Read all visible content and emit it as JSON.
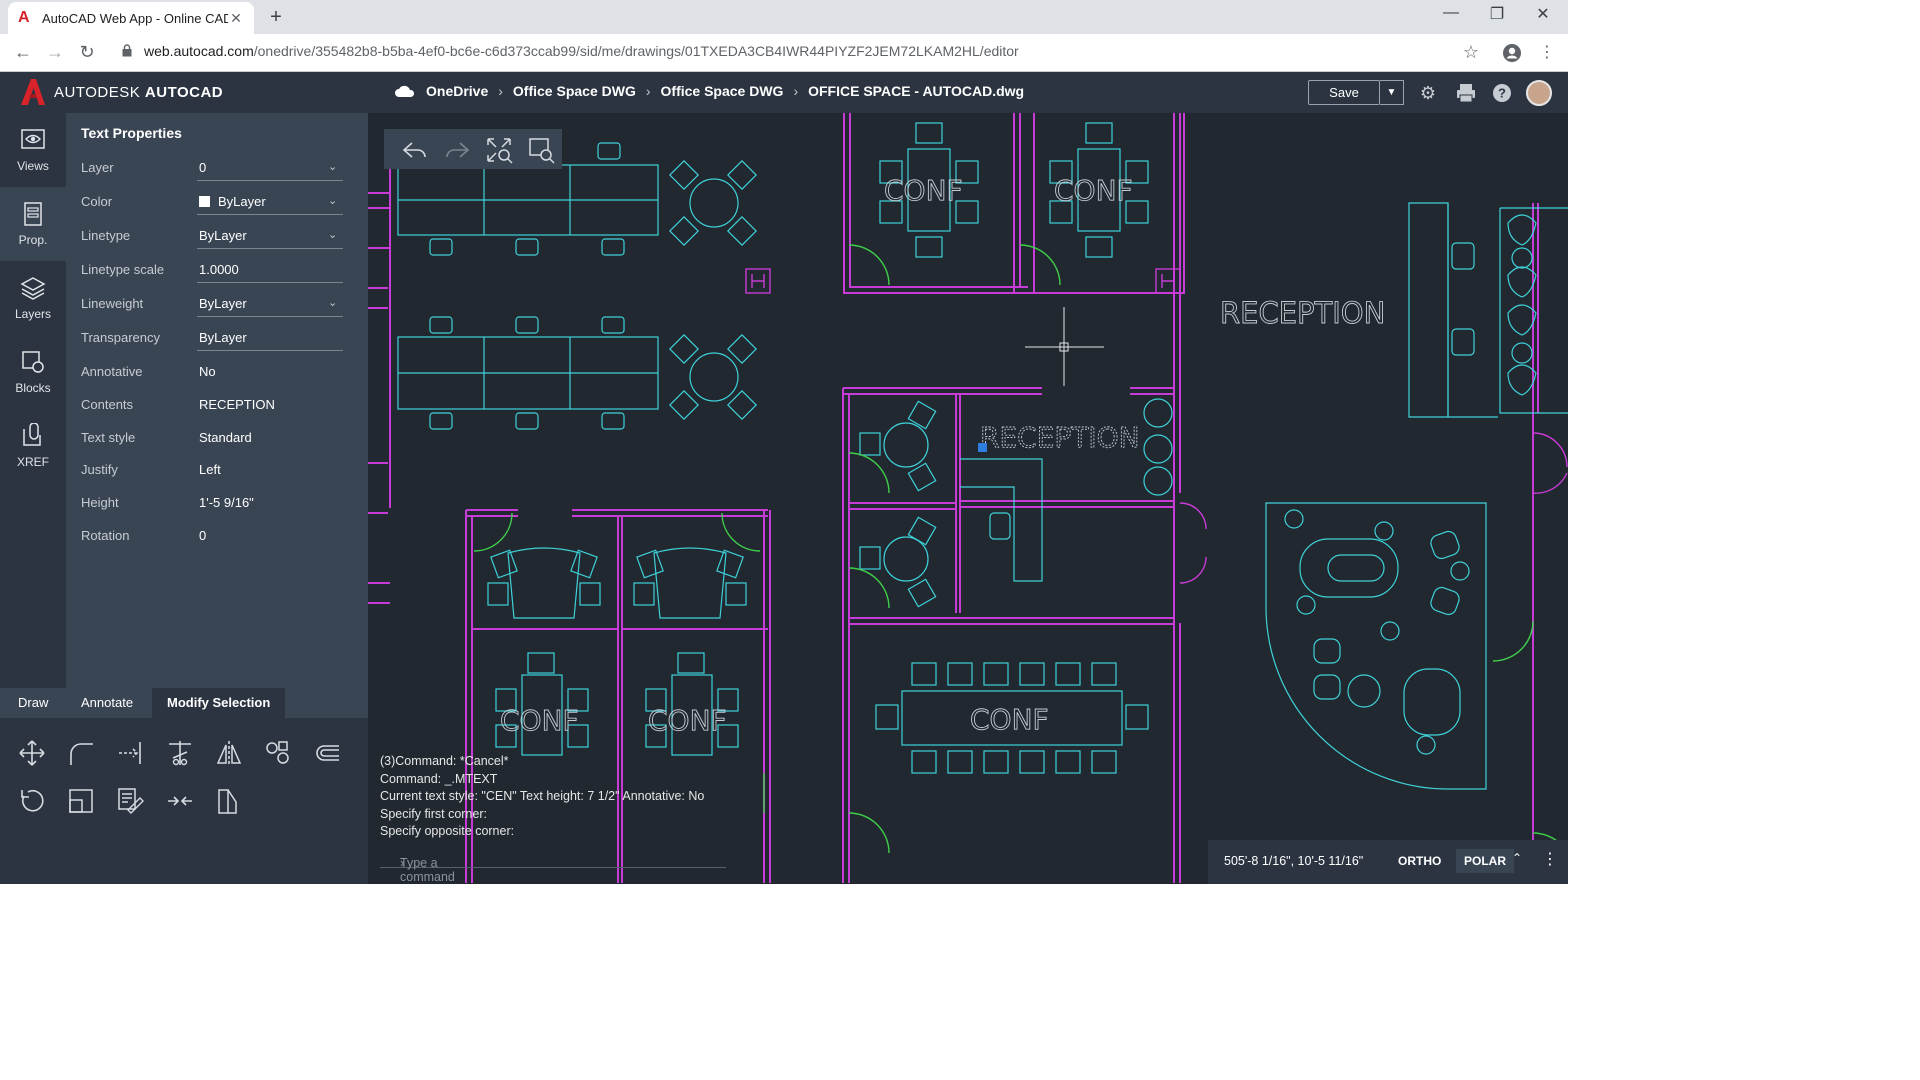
{
  "browser": {
    "tab_title": "AutoCAD Web App - Online CAD",
    "url_host": "web.autocad.com",
    "url_path": "/onedrive/355482b8-b5ba-4ef0-bc6e-c6d373ccab99/sid/me/drawings/01TXEDA3CB4IWR44PIYZF2JEM72LKAM2HL/editor"
  },
  "header": {
    "brand_prefix": "AUTODESK",
    "brand_product": "AUTOCAD",
    "breadcrumbs": [
      "OneDrive",
      "Office Space DWG",
      "Office Space DWG",
      "OFFICE SPACE - AUTOCAD.dwg"
    ],
    "save_label": "Save"
  },
  "rail": {
    "items": [
      {
        "label": "Views",
        "icon": "eye-icon"
      },
      {
        "label": "Prop.",
        "icon": "properties-icon"
      },
      {
        "label": "Layers",
        "icon": "layers-icon"
      },
      {
        "label": "Blocks",
        "icon": "blocks-icon"
      },
      {
        "label": "XREF",
        "icon": "xref-icon"
      }
    ],
    "active_index": 1
  },
  "properties": {
    "title": "Text Properties",
    "rows": [
      {
        "label": "Layer",
        "value": "0",
        "dropdown": true
      },
      {
        "label": "Color",
        "value": "ByLayer",
        "dropdown": true
      },
      {
        "label": "Linetype",
        "value": "ByLayer",
        "dropdown": true
      },
      {
        "label": "Linetype scale",
        "value": "1.0000",
        "dropdown": false
      },
      {
        "label": "Lineweight",
        "value": "ByLayer",
        "dropdown": true
      },
      {
        "label": "Transparency",
        "value": "ByLayer",
        "dropdown": false
      },
      {
        "label": "Annotative",
        "value": "No"
      },
      {
        "label": "Contents",
        "value": "RECEPTION"
      },
      {
        "label": "Text style",
        "value": "Standard"
      },
      {
        "label": "Justify",
        "value": "Left"
      },
      {
        "label": "Height",
        "value": "1'-5 9/16\""
      },
      {
        "label": "Rotation",
        "value": "0"
      }
    ]
  },
  "tools": {
    "tabs": [
      "Draw",
      "Annotate",
      "Modify Selection"
    ],
    "active_tab": "Modify Selection"
  },
  "drawing": {
    "labels": {
      "conf": "CONF",
      "reception": "RECEPTION"
    },
    "colors": {
      "wall": "#c73bd6",
      "furniture": "#3fd1d9",
      "door": "#3fcf4a",
      "grip": "#2f7de1"
    }
  },
  "command": {
    "history": [
      "(3)Command: *Cancel*",
      "Command: _.MTEXT",
      "Current text style: \"CEN\" Text height: 7 1/2\" Annotative: No",
      "Specify first corner:",
      "Specify opposite corner:"
    ],
    "placeholder": "Type a command"
  },
  "status": {
    "coords": "505'-8 1/16\", 10'-5 11/16\"",
    "ortho": "ORTHO",
    "polar": "POLAR"
  }
}
